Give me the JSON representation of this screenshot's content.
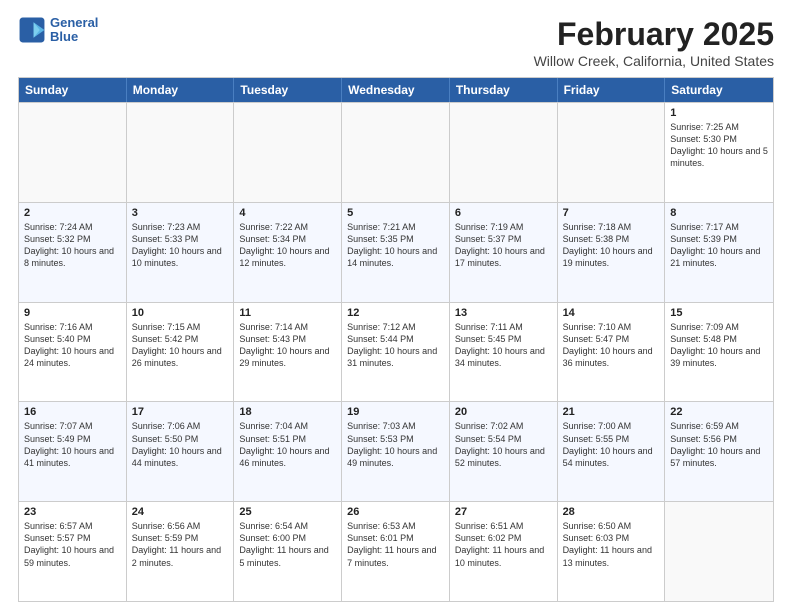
{
  "header": {
    "logo_line1": "General",
    "logo_line2": "Blue",
    "month": "February 2025",
    "location": "Willow Creek, California, United States"
  },
  "day_headers": [
    "Sunday",
    "Monday",
    "Tuesday",
    "Wednesday",
    "Thursday",
    "Friday",
    "Saturday"
  ],
  "weeks": [
    [
      {
        "num": "",
        "info": ""
      },
      {
        "num": "",
        "info": ""
      },
      {
        "num": "",
        "info": ""
      },
      {
        "num": "",
        "info": ""
      },
      {
        "num": "",
        "info": ""
      },
      {
        "num": "",
        "info": ""
      },
      {
        "num": "1",
        "info": "Sunrise: 7:25 AM\nSunset: 5:30 PM\nDaylight: 10 hours\nand 5 minutes."
      }
    ],
    [
      {
        "num": "2",
        "info": "Sunrise: 7:24 AM\nSunset: 5:32 PM\nDaylight: 10 hours\nand 8 minutes."
      },
      {
        "num": "3",
        "info": "Sunrise: 7:23 AM\nSunset: 5:33 PM\nDaylight: 10 hours\nand 10 minutes."
      },
      {
        "num": "4",
        "info": "Sunrise: 7:22 AM\nSunset: 5:34 PM\nDaylight: 10 hours\nand 12 minutes."
      },
      {
        "num": "5",
        "info": "Sunrise: 7:21 AM\nSunset: 5:35 PM\nDaylight: 10 hours\nand 14 minutes."
      },
      {
        "num": "6",
        "info": "Sunrise: 7:19 AM\nSunset: 5:37 PM\nDaylight: 10 hours\nand 17 minutes."
      },
      {
        "num": "7",
        "info": "Sunrise: 7:18 AM\nSunset: 5:38 PM\nDaylight: 10 hours\nand 19 minutes."
      },
      {
        "num": "8",
        "info": "Sunrise: 7:17 AM\nSunset: 5:39 PM\nDaylight: 10 hours\nand 21 minutes."
      }
    ],
    [
      {
        "num": "9",
        "info": "Sunrise: 7:16 AM\nSunset: 5:40 PM\nDaylight: 10 hours\nand 24 minutes."
      },
      {
        "num": "10",
        "info": "Sunrise: 7:15 AM\nSunset: 5:42 PM\nDaylight: 10 hours\nand 26 minutes."
      },
      {
        "num": "11",
        "info": "Sunrise: 7:14 AM\nSunset: 5:43 PM\nDaylight: 10 hours\nand 29 minutes."
      },
      {
        "num": "12",
        "info": "Sunrise: 7:12 AM\nSunset: 5:44 PM\nDaylight: 10 hours\nand 31 minutes."
      },
      {
        "num": "13",
        "info": "Sunrise: 7:11 AM\nSunset: 5:45 PM\nDaylight: 10 hours\nand 34 minutes."
      },
      {
        "num": "14",
        "info": "Sunrise: 7:10 AM\nSunset: 5:47 PM\nDaylight: 10 hours\nand 36 minutes."
      },
      {
        "num": "15",
        "info": "Sunrise: 7:09 AM\nSunset: 5:48 PM\nDaylight: 10 hours\nand 39 minutes."
      }
    ],
    [
      {
        "num": "16",
        "info": "Sunrise: 7:07 AM\nSunset: 5:49 PM\nDaylight: 10 hours\nand 41 minutes."
      },
      {
        "num": "17",
        "info": "Sunrise: 7:06 AM\nSunset: 5:50 PM\nDaylight: 10 hours\nand 44 minutes."
      },
      {
        "num": "18",
        "info": "Sunrise: 7:04 AM\nSunset: 5:51 PM\nDaylight: 10 hours\nand 46 minutes."
      },
      {
        "num": "19",
        "info": "Sunrise: 7:03 AM\nSunset: 5:53 PM\nDaylight: 10 hours\nand 49 minutes."
      },
      {
        "num": "20",
        "info": "Sunrise: 7:02 AM\nSunset: 5:54 PM\nDaylight: 10 hours\nand 52 minutes."
      },
      {
        "num": "21",
        "info": "Sunrise: 7:00 AM\nSunset: 5:55 PM\nDaylight: 10 hours\nand 54 minutes."
      },
      {
        "num": "22",
        "info": "Sunrise: 6:59 AM\nSunset: 5:56 PM\nDaylight: 10 hours\nand 57 minutes."
      }
    ],
    [
      {
        "num": "23",
        "info": "Sunrise: 6:57 AM\nSunset: 5:57 PM\nDaylight: 10 hours\nand 59 minutes."
      },
      {
        "num": "24",
        "info": "Sunrise: 6:56 AM\nSunset: 5:59 PM\nDaylight: 11 hours\nand 2 minutes."
      },
      {
        "num": "25",
        "info": "Sunrise: 6:54 AM\nSunset: 6:00 PM\nDaylight: 11 hours\nand 5 minutes."
      },
      {
        "num": "26",
        "info": "Sunrise: 6:53 AM\nSunset: 6:01 PM\nDaylight: 11 hours\nand 7 minutes."
      },
      {
        "num": "27",
        "info": "Sunrise: 6:51 AM\nSunset: 6:02 PM\nDaylight: 11 hours\nand 10 minutes."
      },
      {
        "num": "28",
        "info": "Sunrise: 6:50 AM\nSunset: 6:03 PM\nDaylight: 11 hours\nand 13 minutes."
      },
      {
        "num": "",
        "info": ""
      }
    ]
  ]
}
